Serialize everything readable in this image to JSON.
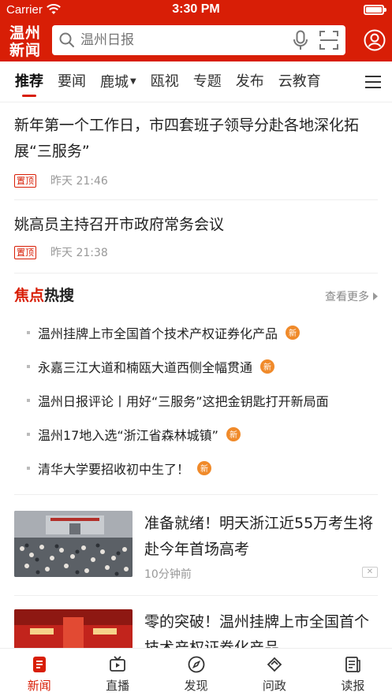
{
  "status": {
    "carrier": "Carrier",
    "time": "3:30 PM",
    "battery_level": 1.0
  },
  "header": {
    "logo_text": "温州新闻",
    "search_placeholder": "温州日报"
  },
  "tabs": [
    {
      "label": "推荐",
      "active": true
    },
    {
      "label": "要闻"
    },
    {
      "label": "鹿城",
      "dropdown": true
    },
    {
      "label": "瓯视"
    },
    {
      "label": "专题"
    },
    {
      "label": "发布"
    },
    {
      "label": "云教育"
    }
  ],
  "news": [
    {
      "title": "新年第一个工作日，市四套班子领导分赴各地深化拓展“三服务”",
      "badge": "置顶",
      "time": "昨天 21:46"
    },
    {
      "title": "姚高员主持召开市政府常务会议",
      "badge": "置顶",
      "time": "昨天 21:38"
    }
  ],
  "hot": {
    "title_red": "焦点",
    "title_black": "热搜",
    "more_label": "查看更多",
    "items": [
      {
        "text": "温州挂牌上市全国首个技术产权证券化产品",
        "badge": "新"
      },
      {
        "text": "永嘉三江大道和楠瓯大道西侧全幅贯通",
        "badge": "新"
      },
      {
        "text": "温州日报评论丨用好“三服务”这把金钥匙打开新局面",
        "badge": ""
      },
      {
        "text": "温州17地入选“浙江省森林城镇”",
        "badge": "新"
      },
      {
        "text": "清华大学要招收初中生了！",
        "badge": "新"
      }
    ]
  },
  "image_news": [
    {
      "title": "准备就绪！明天浙江近55万考生将赴今年首场高考",
      "time": "10分钟前"
    },
    {
      "title": "零的突破！温州挂牌上市全国首个技术产权证券化产品",
      "time": ""
    }
  ],
  "bottom_nav": [
    {
      "label": "新闻",
      "icon": "news-icon",
      "active": true
    },
    {
      "label": "直播",
      "icon": "live-icon"
    },
    {
      "label": "发现",
      "icon": "compass-icon"
    },
    {
      "label": "问政",
      "icon": "handshake-icon"
    },
    {
      "label": "读报",
      "icon": "newspaper-icon"
    }
  ],
  "colors": {
    "brand_red": "#d81e06",
    "badge_orange": "#f08a2a"
  }
}
